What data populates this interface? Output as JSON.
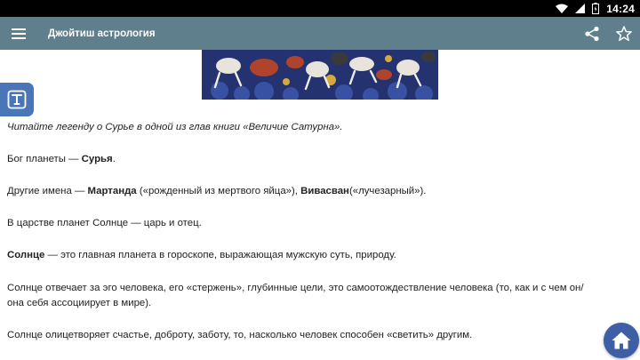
{
  "status_bar": {
    "time": "14:24"
  },
  "app_bar": {
    "title": "Джойтиш астрология"
  },
  "article": {
    "p1": "Читайте легенду о Сурье в одной из глав книги «Величие Сатурна».",
    "p2_a": "Бог планеты — ",
    "p2_b": "Сурья",
    "p2_c": ".",
    "p3_a": "Другие имена — ",
    "p3_b": "Мартанда",
    "p3_c": " («рожденный из мертвого яйца»), ",
    "p3_d": "Вивасван",
    "p3_e": "(«лучезарный»).",
    "p4": "В царстве планет Солнце — царь и отец.",
    "p5_a": "Солнце",
    "p5_b": " — это главная планета в гороскопе, выражающая мужскую суть, природу.",
    "p6_l1": "Солнце отвечает за эго человека, его «стержень», глубинные цели, это самоотождествление человека (то, как и с чем он/",
    "p6_l2": "она себя ассоциирует в мире).",
    "p7": "Солнце олицетворяет счастье, доброту, заботу, то, насколько человек способен «светить» другим."
  },
  "colors": {
    "app_bar": "#5f7f8c",
    "side_tab": "#4a76b8",
    "fab": "#3e5fa5",
    "status_bar": "#000000"
  },
  "icons": [
    "wifi-icon",
    "battery-icon",
    "menu-icon",
    "share-icon",
    "star-icon",
    "text-size-icon",
    "home-icon"
  ]
}
